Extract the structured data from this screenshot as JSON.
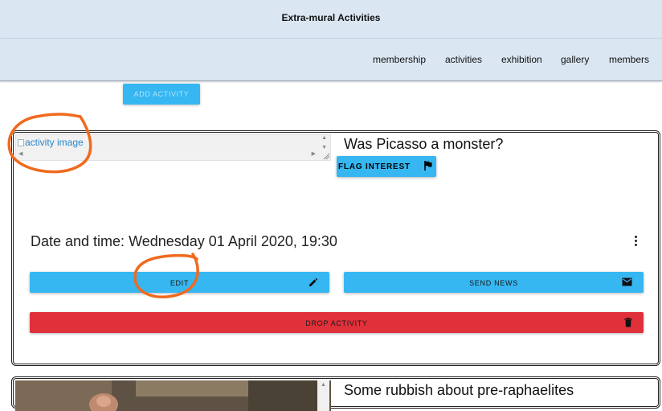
{
  "header": {
    "title": "Extra-mural Activities"
  },
  "nav": {
    "items": [
      "membership",
      "activities",
      "exhibition",
      "gallery",
      "members"
    ]
  },
  "toolbar": {
    "add_label": "ADD ACTIVITY"
  },
  "activities": [
    {
      "image_alt": "activity image",
      "title": "Was Picasso a monster?",
      "flag_label": "FLAG INTEREST",
      "datetime": "Date and time: Wednesday 01 April 2020, 19:30",
      "edit_label": "EDIT",
      "send_news_label": "SEND NEWS",
      "drop_label": "DROP ACTIVITY"
    },
    {
      "title": "Some rubbish about pre-raphaelites"
    }
  ],
  "colors": {
    "header_bg": "#dae6f2",
    "primary": "#36b7f2",
    "danger": "#e0303a",
    "annotation": "#f06a1e"
  },
  "icons": {
    "flag": "flag-icon",
    "edit": "pencil-icon",
    "send_news": "mail-icon",
    "drop": "trash-icon",
    "more": "more-vert-icon"
  }
}
